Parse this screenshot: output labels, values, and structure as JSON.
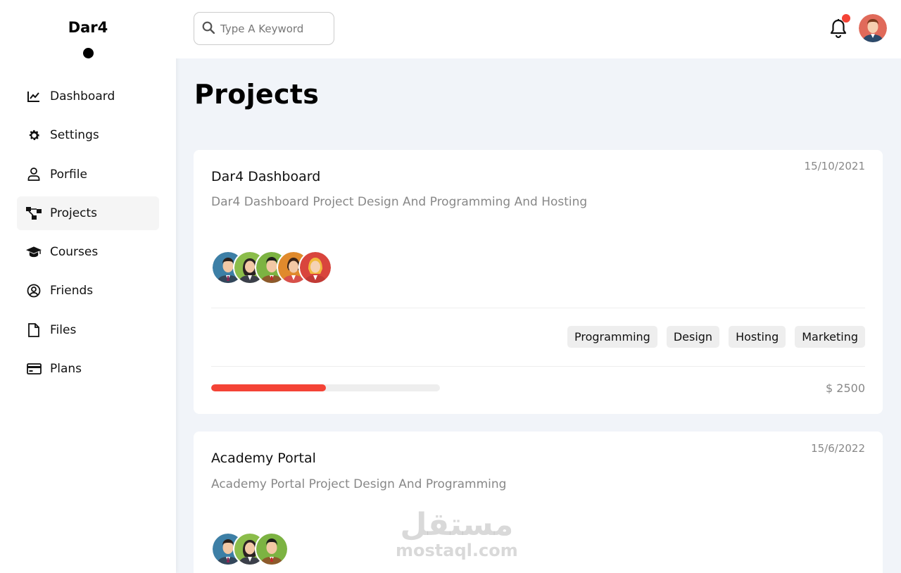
{
  "brand": "Dar4",
  "sidebar": {
    "items": [
      {
        "label": "Dashboard",
        "icon": "chart-line-icon"
      },
      {
        "label": "Settings",
        "icon": "gear-icon"
      },
      {
        "label": "Porfile",
        "icon": "user-icon"
      },
      {
        "label": "Projects",
        "icon": "diagram-icon",
        "active": true
      },
      {
        "label": "Courses",
        "icon": "graduation-cap-icon"
      },
      {
        "label": "Friends",
        "icon": "user-circle-icon"
      },
      {
        "label": "Files",
        "icon": "file-icon"
      },
      {
        "label": "Plans",
        "icon": "credit-card-icon"
      }
    ]
  },
  "header": {
    "search_placeholder": "Type A Keyword",
    "notification": true
  },
  "page_title": "Projects",
  "projects": [
    {
      "title": "Dar4 Dashboard",
      "date": "15/10/2021",
      "description": "Dar4 Dashboard Project Design And Programming And Hosting",
      "team_count": 5,
      "tags": [
        "Programming",
        "Design",
        "Hosting",
        "Marketing"
      ],
      "progress": 0.5,
      "price": "$ 2500"
    },
    {
      "title": "Academy Portal",
      "date": "15/6/2022",
      "description": "Academy Portal Project Design And Programming",
      "team_count": 3
    }
  ],
  "colors": {
    "accent": "#f44336",
    "background": "#f1f4f9"
  },
  "watermark": {
    "arabic": "مستقل",
    "latin": "mostaql.com"
  }
}
